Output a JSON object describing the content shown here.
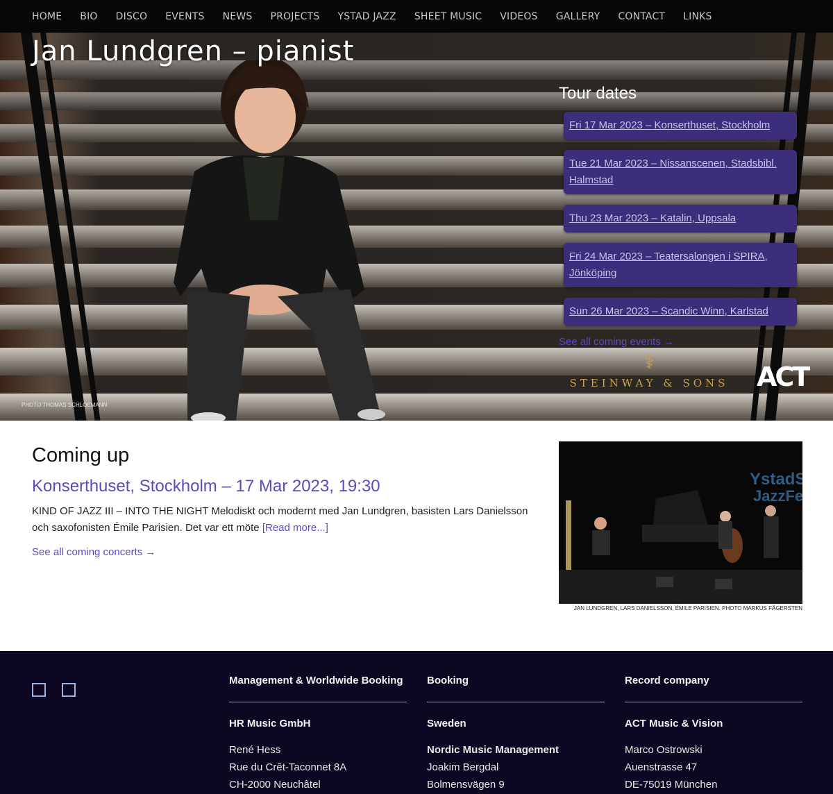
{
  "nav": {
    "items": [
      "HOME",
      "BIO",
      "DISCO",
      "EVENTS",
      "NEWS",
      "PROJECTS",
      "YSTAD JAZZ",
      "SHEET MUSIC",
      "VIDEOS",
      "GALLERY",
      "CONTACT",
      "LINKS"
    ]
  },
  "hero": {
    "title": "Jan Lundgren – pianist",
    "photo_credit": "PHOTO THOMAS SCHLOEMANN"
  },
  "tour": {
    "heading": "Tour dates",
    "items": [
      "Fri 17 Mar 2023 – Konserthuset, Stockholm",
      "Tue 21 Mar 2023 – Nissanscenen, Stadsbibl. Halmstad",
      "Thu 23 Mar 2023 – Katalin, Uppsala",
      "Fri 24 Mar 2023 – Teatersalongen i SPIRA, Jönköping",
      "Sun 26 Mar 2023 – Scandic Winn, Karlstad"
    ],
    "see_all": "See all coming events →"
  },
  "sponsors": {
    "steinway": "STEINWAY & SONS",
    "act": "ACT"
  },
  "coming_up": {
    "heading": "Coming up",
    "event_title": "Konserthuset, Stockholm – 17 Mar 2023, 19:30",
    "description": "KIND OF JAZZ III – INTO THE NIGHT Melodiskt och modernt med Jan Lundgren, basisten Lars Danielsson och saxofonisten Émile Parisien. Det var ett möte ",
    "read_more": "[Read more...]",
    "see_all": "See all coming concerts →",
    "image_sign": "YstadS JazzFes",
    "image_caption": "JAN LUNDGREN, LARS DANIELSSON, ÉMILE PARISIEN. PHOTO MARKUS FÄGERSTEN"
  },
  "footer": {
    "col1": {
      "head": "Management & Worldwide Booking",
      "sub": "HR Music GmbH",
      "lines": [
        "René Hess",
        "Rue du Crêt-Taconnet 8A",
        "CH-2000 Neuchâtel"
      ]
    },
    "col2": {
      "head": "Booking",
      "sub": "Sweden",
      "lines": [
        "Nordic Music Management",
        "Joakim Bergdal",
        "Bolmensvägen 9"
      ]
    },
    "col3": {
      "head": "Record company",
      "sub": "ACT Music & Vision",
      "lines": [
        "Marco Ostrowski",
        "Auenstrasse 47",
        "DE-75019 München"
      ]
    }
  },
  "colors": {
    "accent": "#5a4bc0",
    "tour_bg": "#3c2e7a",
    "footer_bg": "#0e0724",
    "nav_bg": "#070707"
  }
}
